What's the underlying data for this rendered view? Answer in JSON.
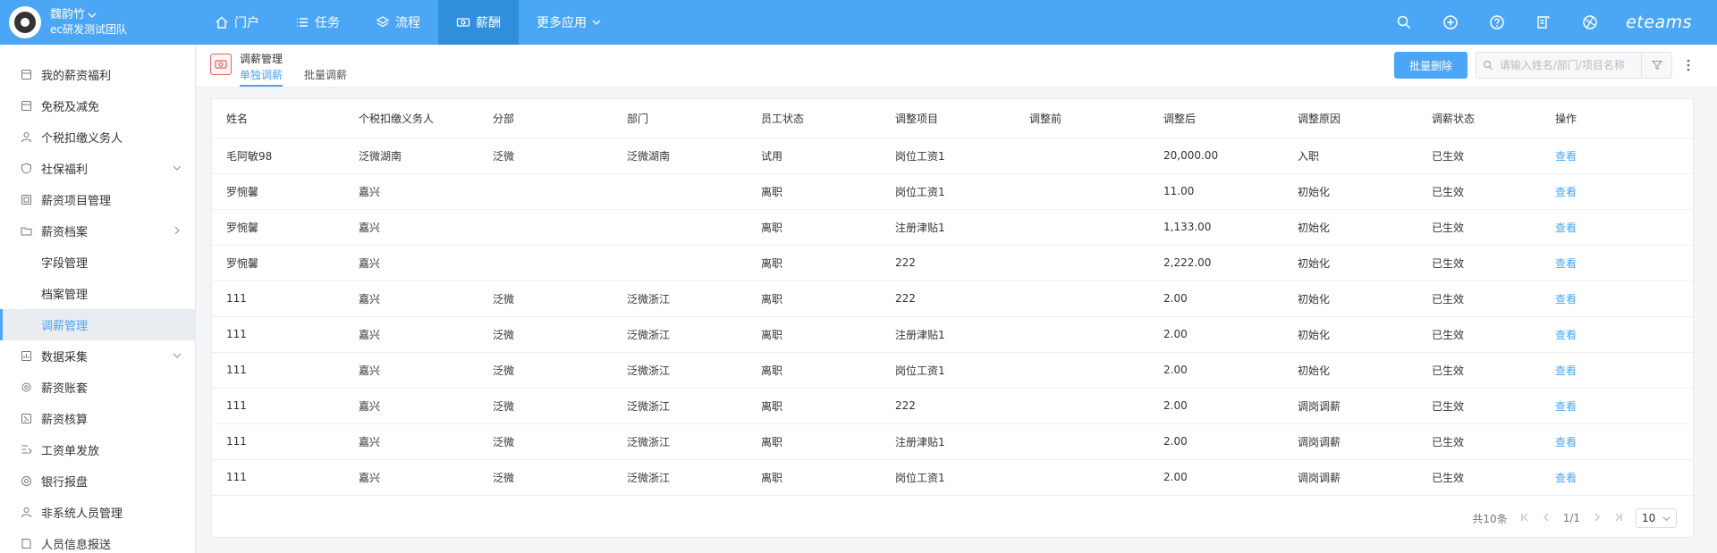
{
  "header": {
    "user": "魏韵竹",
    "team": "ec研发测试团队",
    "nav": [
      {
        "label": "门户",
        "icon": "home-icon"
      },
      {
        "label": "任务",
        "icon": "list-icon"
      },
      {
        "label": "流程",
        "icon": "layers-icon"
      },
      {
        "label": "薪酬",
        "icon": "money-icon",
        "active": true
      },
      {
        "label": "更多应用",
        "icon": "chevron-down-icon"
      }
    ],
    "brand_text": "eteams"
  },
  "sidebar": {
    "items": [
      {
        "label": "我的薪资福利",
        "icon": "box-icon"
      },
      {
        "label": "免税及减免",
        "icon": "box-icon"
      },
      {
        "label": "个税扣缴义务人",
        "icon": "person-icon"
      },
      {
        "label": "社保福利",
        "icon": "shield-icon",
        "arrow": "down"
      },
      {
        "label": "薪资项目管理",
        "icon": "doc-icon"
      },
      {
        "label": "薪资档案",
        "icon": "folder-icon",
        "arrow": "right"
      },
      {
        "label": "字段管理",
        "sub": true
      },
      {
        "label": "档案管理",
        "sub": true
      },
      {
        "label": "调薪管理",
        "sub": true,
        "active": true
      },
      {
        "label": "数据采集",
        "icon": "data-icon",
        "arrow": "down"
      },
      {
        "label": "薪资账套",
        "icon": "gear-icon"
      },
      {
        "label": "薪资核算",
        "icon": "calc-icon"
      },
      {
        "label": "工资单发放",
        "icon": "send-icon"
      },
      {
        "label": "银行报盘",
        "icon": "at-icon"
      },
      {
        "label": "非系统人员管理",
        "icon": "person-icon"
      },
      {
        "label": "人员信息报送",
        "icon": "report-icon"
      }
    ]
  },
  "content": {
    "module_title": "调薪管理",
    "tabs": [
      "单独调薪",
      "批量调薪"
    ],
    "batch_delete": "批量删除",
    "search_placeholder": "请输入姓名/部门/项目名称"
  },
  "table": {
    "columns": [
      "姓名",
      "个税扣缴义务人",
      "分部",
      "部门",
      "员工状态",
      "调整项目",
      "调整前",
      "调整后",
      "调整原因",
      "调薪状态",
      "操作"
    ],
    "rows": [
      [
        "毛阿敏98",
        "泛微湖南",
        "泛微",
        "泛微湖南",
        "试用",
        "岗位工资1",
        "",
        "20,000.00",
        "入职",
        "已生效",
        "查看"
      ],
      [
        "罗惋馨",
        "嘉兴",
        "",
        "",
        "离职",
        "岗位工资1",
        "",
        "11.00",
        "初始化",
        "已生效",
        "查看"
      ],
      [
        "罗惋馨",
        "嘉兴",
        "",
        "",
        "离职",
        "注册津贴1",
        "",
        "1,133.00",
        "初始化",
        "已生效",
        "查看"
      ],
      [
        "罗惋馨",
        "嘉兴",
        "",
        "",
        "离职",
        "222",
        "",
        "2,222.00",
        "初始化",
        "已生效",
        "查看"
      ],
      [
        "111",
        "嘉兴",
        "泛微",
        "泛微浙江",
        "离职",
        "222",
        "",
        "2.00",
        "初始化",
        "已生效",
        "查看"
      ],
      [
        "111",
        "嘉兴",
        "泛微",
        "泛微浙江",
        "离职",
        "注册津贴1",
        "",
        "2.00",
        "初始化",
        "已生效",
        "查看"
      ],
      [
        "111",
        "嘉兴",
        "泛微",
        "泛微浙江",
        "离职",
        "岗位工资1",
        "",
        "2.00",
        "初始化",
        "已生效",
        "查看"
      ],
      [
        "111",
        "嘉兴",
        "泛微",
        "泛微浙江",
        "离职",
        "222",
        "",
        "2.00",
        "调岗调薪",
        "已生效",
        "查看"
      ],
      [
        "111",
        "嘉兴",
        "泛微",
        "泛微浙江",
        "离职",
        "注册津贴1",
        "",
        "2.00",
        "调岗调薪",
        "已生效",
        "查看"
      ],
      [
        "111",
        "嘉兴",
        "泛微",
        "泛微浙江",
        "离职",
        "岗位工资1",
        "",
        "2.00",
        "调岗调薪",
        "已生效",
        "查看"
      ]
    ]
  },
  "pagination": {
    "total": "共10条",
    "page": "1/1",
    "page_size": "10"
  }
}
